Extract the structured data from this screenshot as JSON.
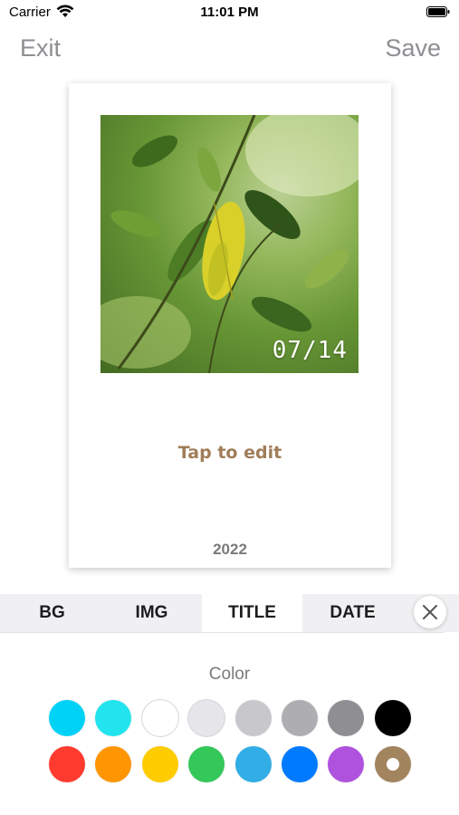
{
  "status_bar": {
    "carrier": "Carrier",
    "time": "11:01 PM"
  },
  "nav": {
    "exit_label": "Exit",
    "save_label": "Save"
  },
  "card": {
    "photo_date": "07/14",
    "title": "Tap to edit",
    "year": "2022"
  },
  "tabs": [
    {
      "label": "BG",
      "active": false
    },
    {
      "label": "IMG",
      "active": false
    },
    {
      "label": "TITLE",
      "active": true
    },
    {
      "label": "DATE",
      "active": false
    }
  ],
  "color_section": {
    "label": "Color",
    "rows": [
      [
        "#00d2f7",
        "#22e4ee",
        "#ffffff",
        "#e5e5ea",
        "#c7c7cc",
        "#aeaeb2",
        "#8e8e93",
        "#000000"
      ],
      [
        "#ff3b30",
        "#ff9500",
        "#ffcc00",
        "#34c759",
        "#32ade6",
        "#007aff",
        "#af52de",
        "#a2845e"
      ]
    ],
    "selected": "#a2845e"
  },
  "icons": {
    "wifi": "wifi-icon",
    "battery": "battery-icon",
    "close": "close-icon"
  }
}
